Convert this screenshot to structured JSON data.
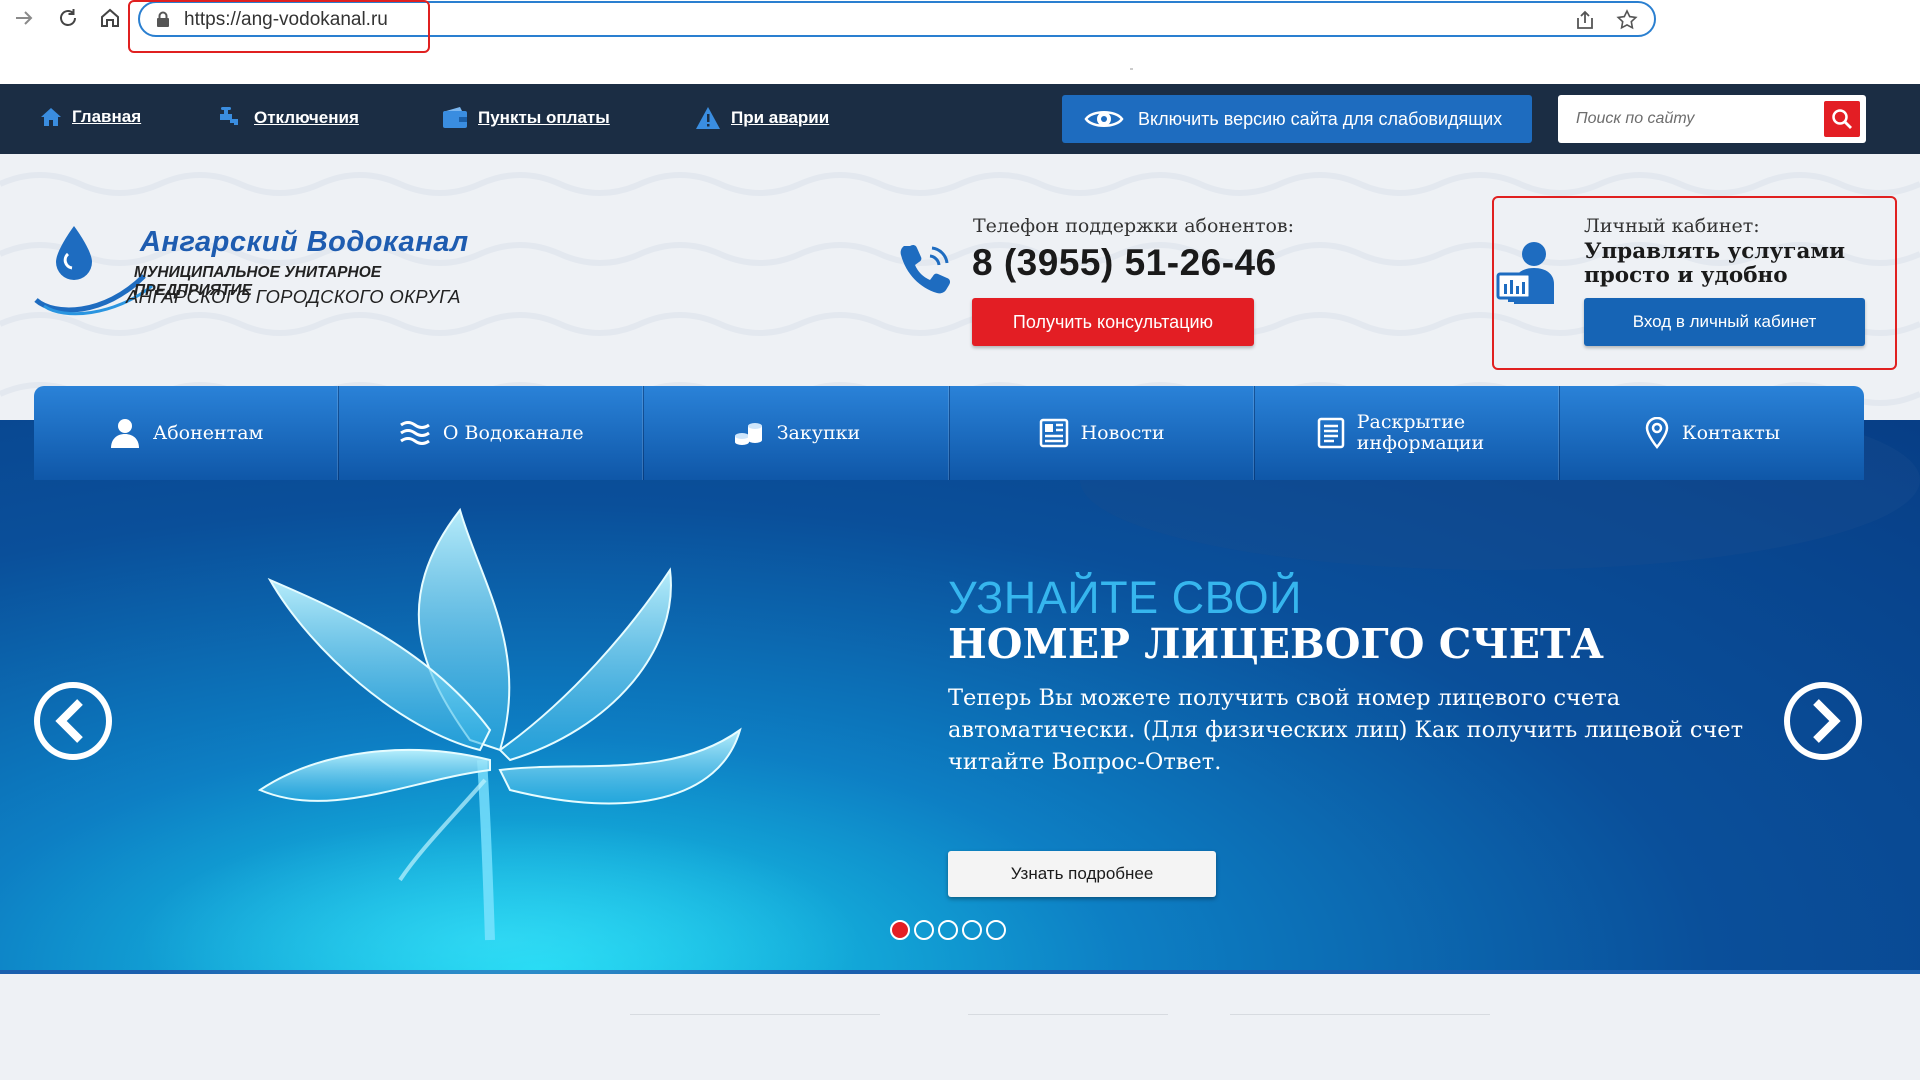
{
  "browser": {
    "url": "https://ang-vodokanal.ru",
    "icons": [
      "forward-icon",
      "reload-icon",
      "home-icon",
      "lock-icon",
      "share-icon",
      "star-icon"
    ]
  },
  "topbar": {
    "items": [
      {
        "label": "Главная",
        "icon": "home-icon"
      },
      {
        "label": "Отключения",
        "icon": "faucet-icon"
      },
      {
        "label": "Пункты оплаты",
        "icon": "wallet-icon"
      },
      {
        "label": "При аварии",
        "icon": "warning-icon"
      }
    ],
    "low_vision_label": "Включить версию сайта для слабовидящих",
    "search_placeholder": "Поиск по сайту"
  },
  "logo": {
    "name": "Ангарский Водоканал",
    "line2": "МУНИЦИПАЛЬНОЕ УНИТАРНОЕ ПРЕДПРИЯТИЕ",
    "line3": "АНГАРСКОГО ГОРОДСКОГО ОКРУГА"
  },
  "support": {
    "label": "Телефон поддержки абонентов:",
    "phone": "8 (3955) 51-26-46",
    "button": "Получить консультацию"
  },
  "cabinet": {
    "label": "Личный кабинет:",
    "title": "Управлять услугами просто и удобно",
    "button": "Вход в личный кабинет"
  },
  "mainnav": {
    "items": [
      {
        "label": "Абонентам",
        "icon": "user-icon"
      },
      {
        "label": "О Водоканале",
        "icon": "waves-icon"
      },
      {
        "label": "Закупки",
        "icon": "coins-icon"
      },
      {
        "label": "Новости",
        "icon": "newspaper-icon"
      },
      {
        "label": "Раскрытие информации",
        "icon": "document-icon"
      },
      {
        "label": "Контакты",
        "icon": "location-pin-icon"
      }
    ]
  },
  "slide": {
    "kicker": "УЗНАЙТЕ СВОЙ",
    "title": "НОМЕР ЛИЦЕВОГО СЧЕТА",
    "text": "Теперь Вы можете получить свой номер лицевого счета автоматически. (Для физических лиц) Как получить лицевой счет читайте Вопрос-Ответ.",
    "button": "Узнать подробнее",
    "total_slides": 5,
    "active_slide": 1
  },
  "colors": {
    "accent_red": "#e31e24",
    "brand_blue": "#1664b5",
    "topbar_bg": "#1b2d44",
    "highlight_box": "#e02020"
  }
}
